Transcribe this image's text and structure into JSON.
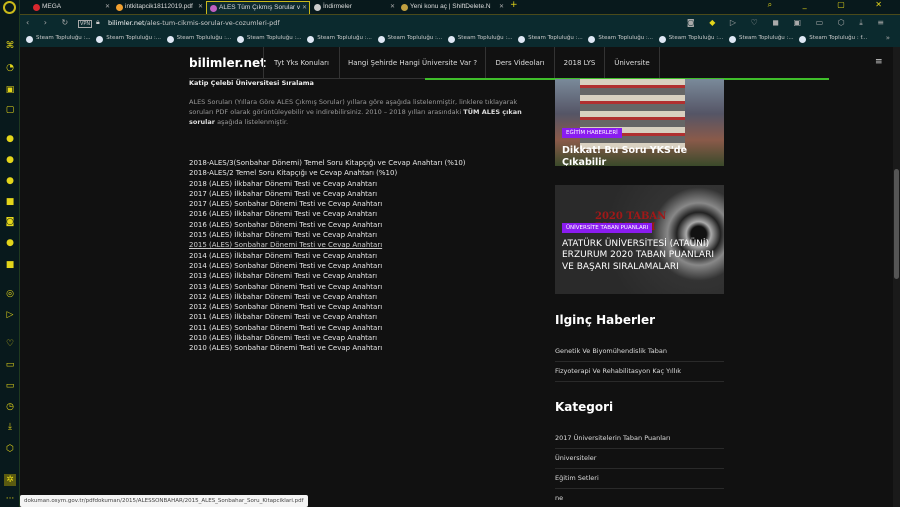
{
  "tabs": [
    {
      "label": "MEGA",
      "color": "#d9272e"
    },
    {
      "label": "intkitapcik18112019.pdf",
      "color": "#f0a030"
    },
    {
      "label": "ALES Tüm Çıkmış Sorular v",
      "color": "#c060c0"
    },
    {
      "label": "İndirmeler",
      "color": "#cccccc"
    },
    {
      "label": "Yeni konu aç | ShiftDelete.N",
      "color": "#c0a040"
    }
  ],
  "address": {
    "vpn": "VPN",
    "domain": "bilimler.net",
    "path": "/ales-tum-cikmis-sorular-ve-cozumleri-pdf"
  },
  "bookmarks": [
    "Steam Topluluğu :...",
    "Steam Topluluğu :...",
    "Steam Topluluğu :...",
    "Steam Topluluğu :...",
    "Steam Topluluğu :...",
    "Steam Topluluğu :...",
    "Steam Topluluğu :...",
    "Steam Topluluğu :...",
    "Steam Topluluğu :...",
    "Steam Topluluğu :...",
    "Steam Topluluğu :...",
    "Steam Topluluğu : f..."
  ],
  "site": {
    "brand": "bilimler.net",
    "nav": [
      "Tyt Yks Konuları",
      "Hangi Şehirde Hangi Üniversite Var ?",
      "Ders Videoları",
      "2018 LYS",
      "Üniversite"
    ],
    "breadcrumb": "Katip Çelebi Üniversitesi Sıralama",
    "intro_a": "ALES Soruları (Yıllara Göre ALES Çıkmış Sorular) yıllara göre aşağıda listelenmiştir, linklere tıklayarak soruları PDF olarak görüntüleyebilir ve indirebilirsiniz. 2010 – 2018 yılları arasındaki ",
    "intro_bold1": "TÜM ALES çıkan sorular",
    "intro_b": " aşağıda listelenmiştir.",
    "links": [
      "2018-ALES/3(Sonbahar Dönemi) Temel Soru Kitapçığı ve Cevap Anahtarı (%10)",
      "2018-ALES/2 Temel Soru Kitapçığı ve Cevap Anahtarı (%10)",
      "2018 (ALES) İlkbahar Dönemi Testi ve Cevap Anahtarı",
      "2017  (ALES) İlkbahar Dönemi Testi ve Cevap Anahtarı",
      "2017  (ALES) Sonbahar Dönemi Testi ve Cevap Anahtarı",
      "2016  (ALES) İlkbahar Dönemi Testi ve Cevap Anahtarı",
      "2016  (ALES) Sonbahar Dönemi Testi ve Cevap Anahtarı",
      "2015 (ALES) İlkbahar Dönemi Testi ve Cevap Anahtarı",
      "2015 (ALES) Sonbahar Dönemi Testi ve Cevap Anahtarı",
      "2014  (ALES) İlkbahar Dönemi Testi ve Cevap Anahtarı",
      "2014 (ALES) Sonbahar Dönemi Testi ve Cevap Anahtarı",
      "2013  (ALES) İlkbahar Dönemi Testi ve Cevap Anahtarı",
      "2013 (ALES) Sonbahar Dönemi Testi ve Cevap Anahtarı",
      "2012 (ALES) İlkbahar Dönemi Testi ve Cevap Anahtarı",
      "2012 (ALES) Sonbahar Dönemi Testi ve Cevap Anahtarı",
      "2011 (ALES) İlkbahar Dönemi Testi ve Cevap Anahtarı",
      "2011  (ALES) Sonbahar Dönemi Testi ve Cevap Anahtarı",
      "2010 (ALES) İlkbahar Dönemi Testi ve Cevap Anahtarı",
      "2010  (ALES) Sonbahar Dönemi Testi ve Cevap Anahtarı"
    ],
    "cards": [
      {
        "badge": "EĞİTİM HABERLERİ",
        "title": "Dikkat! Bu Soru YKS'de Çıkabilir"
      },
      {
        "badge": "ÜNİVERSİTE TABAN PUANLARI",
        "title": "ATATÜRK ÜNİVERSİTESİ (ATAÜNİ) ERZURUM 2020 TABAN PUANLARI VE BAŞARI SIRALAMALARI",
        "image_text": "2020 TABAN PUANLARI"
      }
    ],
    "interesting_title": "Ilginç Haberler",
    "interesting": [
      "Genetik Ve Biyomühendislik Taban",
      "Fizyoterapi Ve Rehabilitasyon Kaç Yıllık"
    ],
    "category_title": "Kategori",
    "categories": [
      "2017 Üniversitelerin Taban Puanları",
      "Üniversiteler",
      "Eğitim Setleri",
      "ne"
    ]
  },
  "status_url": "dokuman.osym.gov.tr/pdfdokuman/2015/ALESSONBAHAR/2015_ALES_Sonbahar_Soru_Kitapciklari.pdf"
}
